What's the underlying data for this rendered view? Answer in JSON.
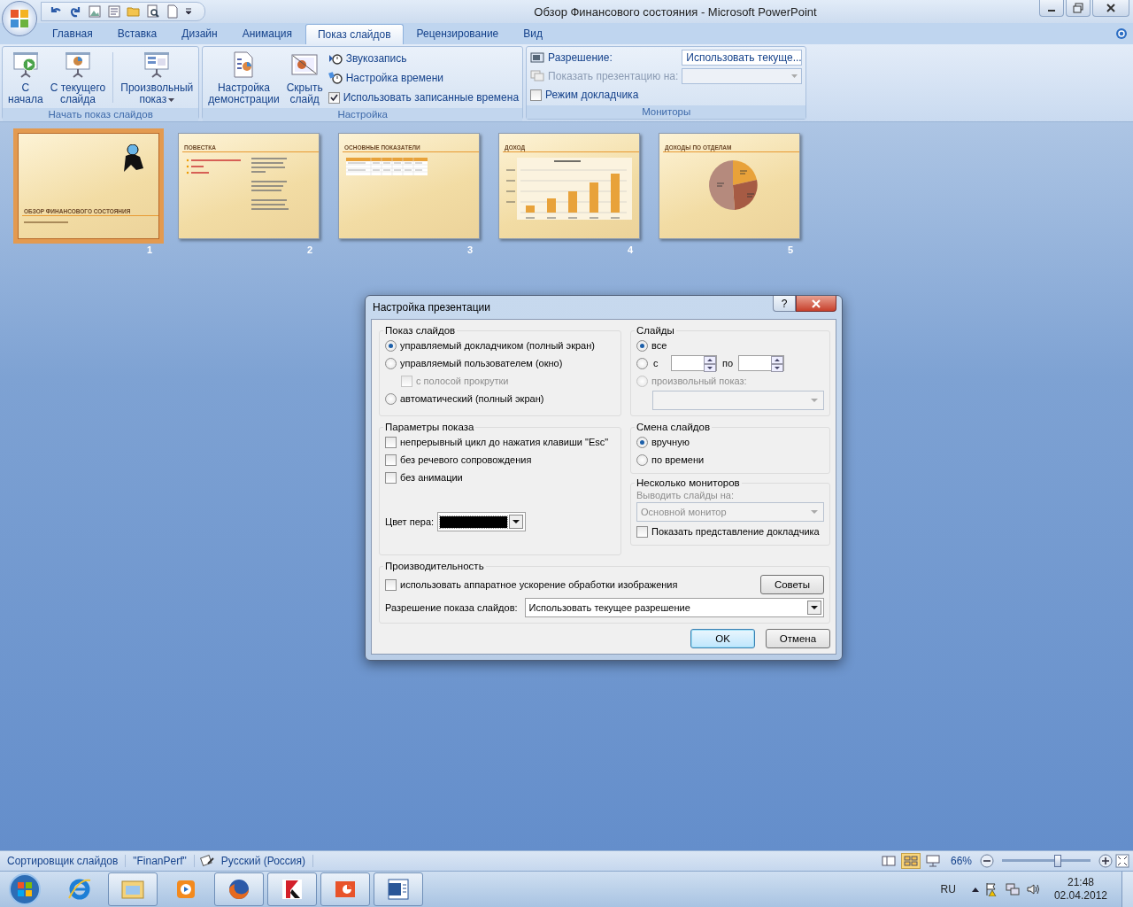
{
  "window": {
    "title": "Обзор Финансового состояния - Microsoft PowerPoint"
  },
  "tabs": [
    {
      "label": "Главная",
      "selected": false
    },
    {
      "label": "Вставка",
      "selected": false
    },
    {
      "label": "Дизайн",
      "selected": false
    },
    {
      "label": "Анимация",
      "selected": false
    },
    {
      "label": "Показ слайдов",
      "selected": true
    },
    {
      "label": "Рецензирование",
      "selected": false
    },
    {
      "label": "Вид",
      "selected": false
    }
  ],
  "ribbon": {
    "start_group": {
      "title": "Начать показ слайдов",
      "buttons": [
        {
          "kind": "play",
          "lines": [
            "С",
            "начала"
          ],
          "dropdown": false
        },
        {
          "kind": "current",
          "lines": [
            "С текущего",
            "слайда"
          ],
          "dropdown": false
        },
        {
          "kind": "custom",
          "lines": [
            "Произвольный",
            "показ"
          ],
          "dropdown": true
        }
      ]
    },
    "setup_group": {
      "title": "Настройка",
      "buttons": [
        {
          "kind": "setup",
          "lines": [
            "Настройка",
            "демонстрации"
          ],
          "dropdown": false
        },
        {
          "kind": "hide",
          "lines": [
            "Скрыть",
            "слайд"
          ],
          "dropdown": false
        }
      ],
      "commands": [
        {
          "kind": "record",
          "label": "Звукозапись"
        },
        {
          "kind": "timing",
          "label": "Настройка времени"
        }
      ],
      "checkbox": {
        "label": "Использовать записанные времена",
        "checked": true
      }
    },
    "monitors_group": {
      "title": "Мониторы",
      "resolution": {
        "label": "Разрешение:",
        "value": "Использовать текуще..."
      },
      "show_on": {
        "label": "Показать презентацию на:",
        "disabled": true
      },
      "checkbox": {
        "label": "Режим докладчика",
        "checked": false
      }
    }
  },
  "slides": [
    {
      "number": "1",
      "kind": "title",
      "title": "ОБЗОР ФИНАНСОВОГО СОСТОЯНИЯ",
      "selected": true
    },
    {
      "number": "2",
      "kind": "agenda",
      "title": "ПОВЕСТКА",
      "selected": false
    },
    {
      "number": "3",
      "kind": "table",
      "title": "ОСНОВНЫЕ ПОКАЗАТЕЛИ",
      "selected": false
    },
    {
      "number": "4",
      "kind": "chart",
      "title": "ДОХОД",
      "selected": false
    },
    {
      "number": "5",
      "kind": "pie",
      "title": "ДОХОДЫ ПО ОТДЕЛАМ",
      "selected": false
    }
  ],
  "dialog": {
    "title": "Настройка презентации",
    "help_button": "?",
    "show_type": {
      "title": "Показ слайдов",
      "options": [
        {
          "label": "управляемый докладчиком (полный экран)",
          "selected": true
        },
        {
          "label": "управляемый пользователем (окно)",
          "selected": false,
          "children": [
            {
              "label": "с полосой прокрутки",
              "checked": false,
              "disabled": true
            }
          ]
        },
        {
          "label": "автоматический (полный экран)",
          "selected": false
        }
      ]
    },
    "slides": {
      "title": "Слайды",
      "all": {
        "label": "все",
        "selected": true
      },
      "range": {
        "label": "с",
        "to_label": "по",
        "selected": false
      },
      "custom": {
        "label": "произвольный показ:",
        "selected": false,
        "disabled": true
      }
    },
    "show_options": {
      "title": "Параметры показа",
      "checkboxes": [
        {
          "label": "непрерывный цикл до нажатия клавиши \"Esc\"",
          "checked": false
        },
        {
          "label": "без речевого сопровождения",
          "checked": false
        },
        {
          "label": "без анимации",
          "checked": false
        }
      ],
      "pen_color": {
        "label": "Цвет пера:",
        "color": "#000000"
      }
    },
    "advance": {
      "title": "Смена слайдов",
      "options": [
        {
          "label": "вручную",
          "selected": true
        },
        {
          "label": "по времени",
          "selected": false
        }
      ]
    },
    "monitors": {
      "title": "Несколько мониторов",
      "label": "Выводить слайды на:",
      "value": "Основной монитор",
      "disabled": true,
      "checkbox": {
        "label": "Показать представление докладчика",
        "checked": false
      }
    },
    "performance": {
      "title": "Производительность",
      "checkbox": {
        "label": "использовать аппаратное ускорение обработки изображения",
        "checked": false
      },
      "tips_button": "Советы",
      "resolution": {
        "label": "Разрешение показа слайдов:",
        "value": "Использовать текущее разрешение"
      }
    },
    "buttons": [
      {
        "label": "OK",
        "default": true
      },
      {
        "label": "Отмена",
        "default": false
      }
    ]
  },
  "status_bar": {
    "items": [
      "Сортировщик слайдов",
      "\"FinanPerf\"",
      "Русский (Россия)"
    ],
    "views": [
      {
        "kind": "normal",
        "selected": false
      },
      {
        "kind": "sorter",
        "selected": true
      },
      {
        "kind": "reading",
        "selected": false
      }
    ],
    "zoom": "66%",
    "zoom_level": {
      "level": 0.63
    }
  },
  "taskbar": {
    "apps": [
      {
        "kind": "ie",
        "running": false
      },
      {
        "kind": "explorer",
        "running": true
      },
      {
        "kind": "media",
        "running": false
      },
      {
        "kind": "firefox",
        "running": true
      },
      {
        "kind": "antivirus",
        "running": true
      },
      {
        "kind": "powerpoint",
        "running": true
      },
      {
        "kind": "word",
        "running": true
      }
    ],
    "language": "RU",
    "time": "21:48",
    "date": "02.04.2012"
  }
}
